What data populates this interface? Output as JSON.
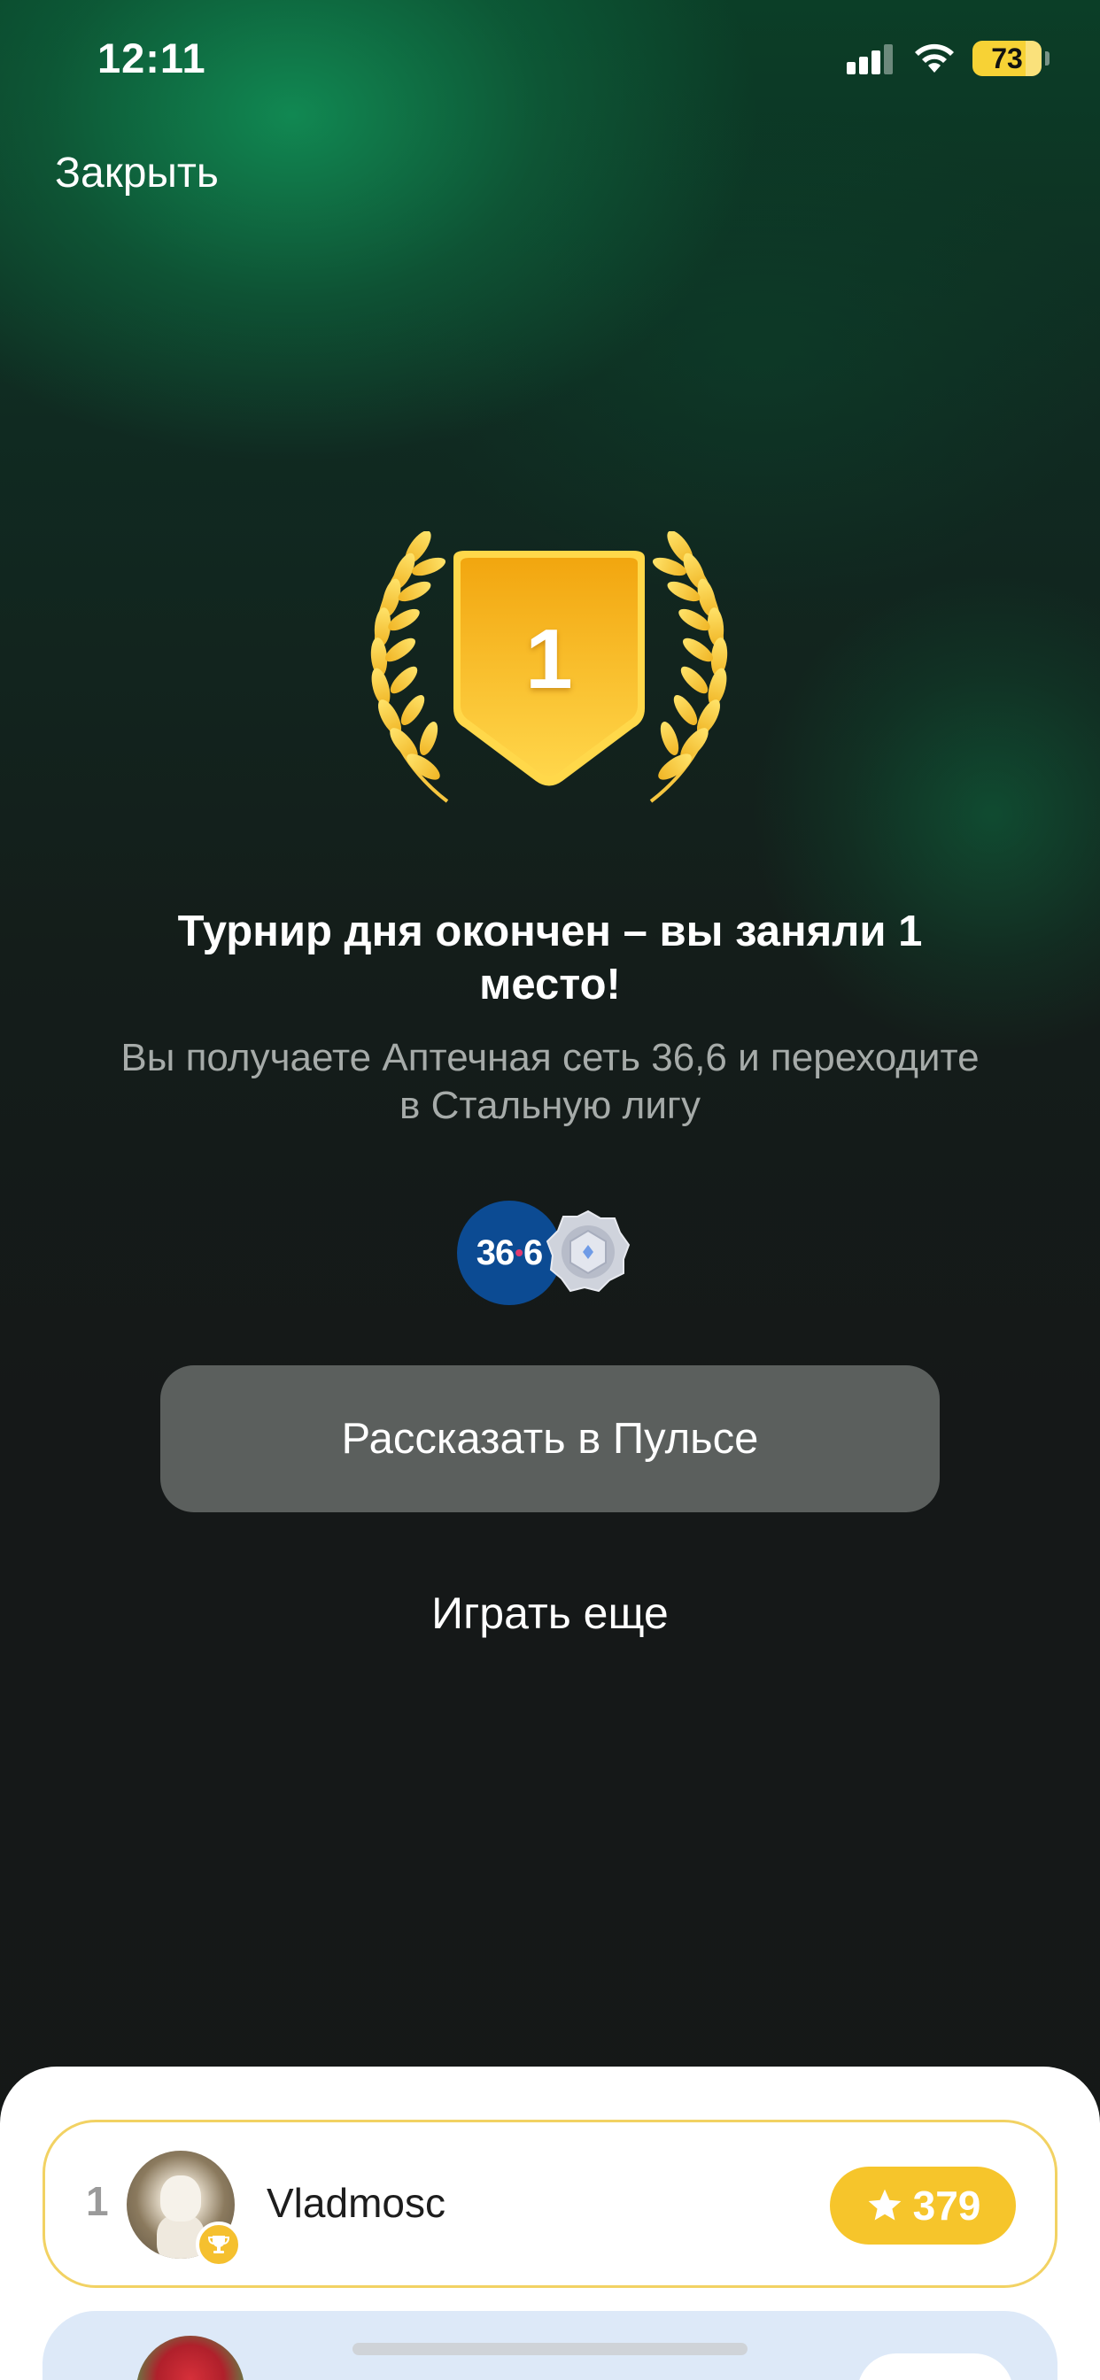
{
  "status_bar": {
    "time": "12:11",
    "battery": "73",
    "icons": [
      "signal-icon",
      "wifi-icon",
      "battery-icon"
    ]
  },
  "header": {
    "close_label": "Закрыть"
  },
  "result": {
    "place": "1",
    "headline": "Турнир дня окончен – вы заняли 1 место!",
    "subtext": "Вы получаете Аптечная сеть 36,6 и переходите в Стальную лигу",
    "reward_logo_text": "36",
    "reward_logo_text2": "6"
  },
  "actions": {
    "share_label": "Рассказать в Пульсе",
    "play_again_label": "Играть еще"
  },
  "leaderboard": {
    "rows": [
      {
        "rank": "1",
        "name": "Vladmosc",
        "score": "379"
      }
    ]
  },
  "colors": {
    "accent_gold": "#f6c52b",
    "button_gray": "#5b5f5d",
    "pharmacy_blue": "#0c4b93"
  }
}
